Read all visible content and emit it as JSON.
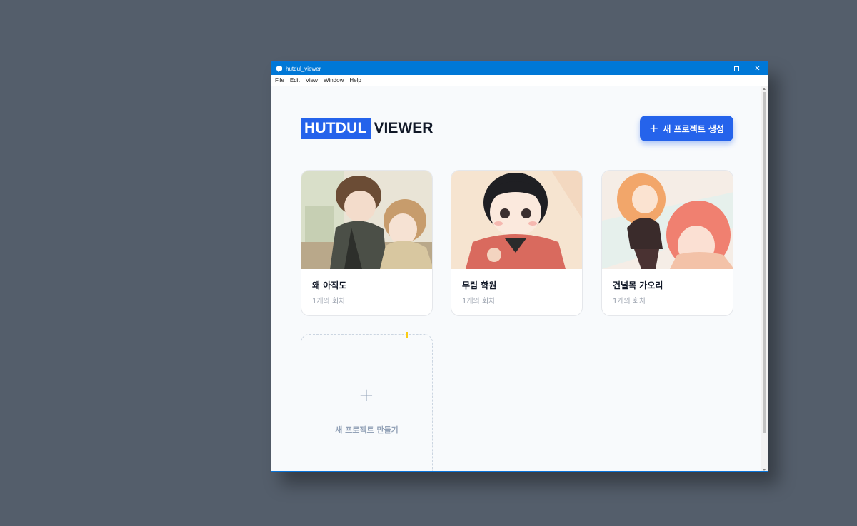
{
  "window": {
    "title": "hutdul_viewer"
  },
  "menu": [
    "File",
    "Edit",
    "View",
    "Window",
    "Help"
  ],
  "header": {
    "logo_highlight": "HUTDUL",
    "logo_rest": "VIEWER",
    "new_project_label": "새 프로젝트 생성"
  },
  "projects": [
    {
      "title": "왜 아직도",
      "episodes": "1개의 회차"
    },
    {
      "title": "무림 학원",
      "episodes": "1개의 회차"
    },
    {
      "title": "건널목 가오리",
      "episodes": "1개의 회차"
    }
  ],
  "add_card": {
    "label": "새 프로젝트 만들기"
  },
  "colors": {
    "accent": "#2563eb",
    "titlebar": "#0078d7",
    "desktop": "#545e6b"
  }
}
